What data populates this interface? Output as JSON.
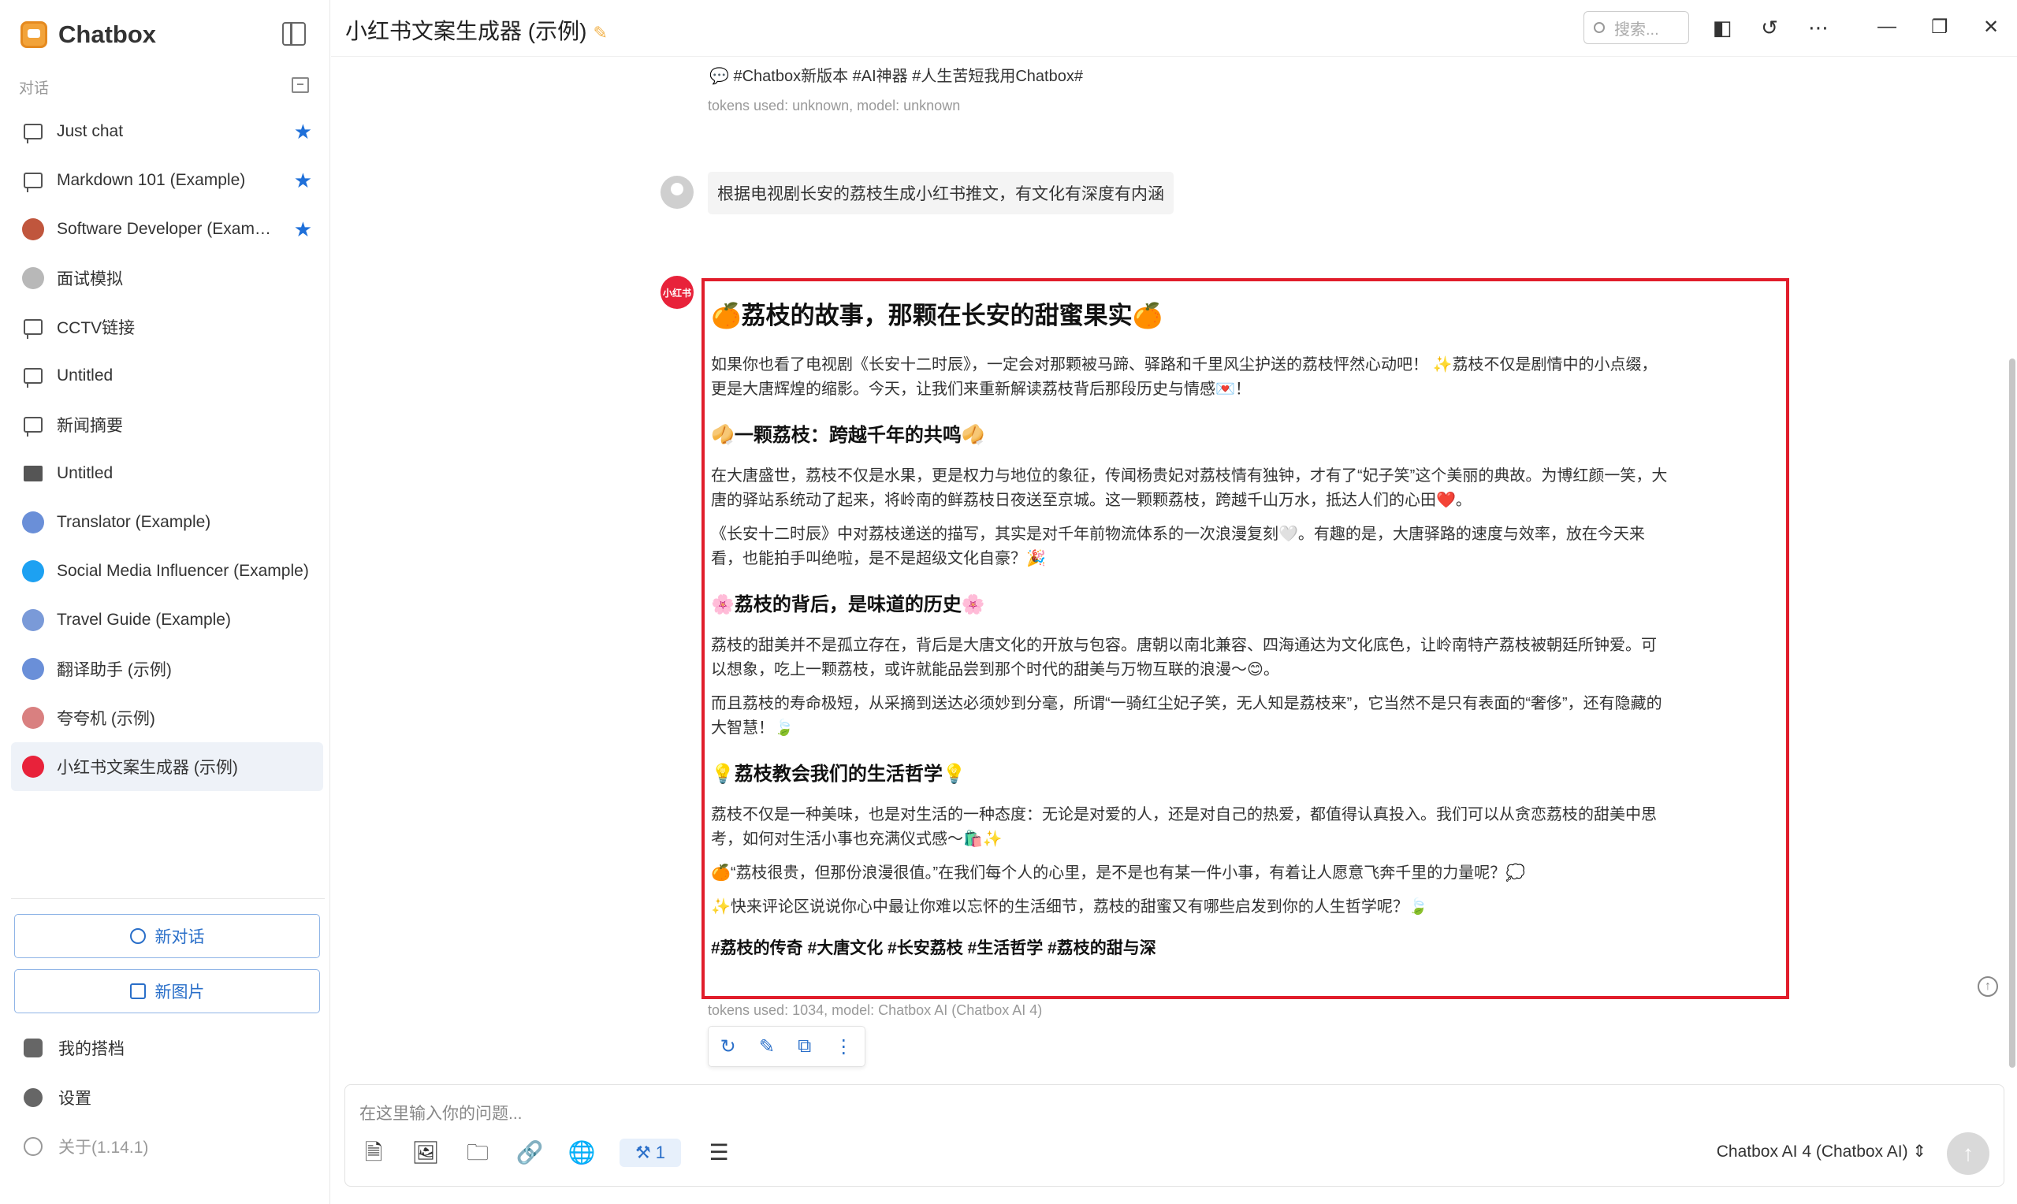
{
  "app": {
    "name": "Chatbox",
    "version_label": "关于(1.14.1)"
  },
  "sidebar": {
    "section_label": "对话",
    "items": [
      {
        "label": "Just chat",
        "starred": true,
        "icon": "chat-icon"
      },
      {
        "label": "Markdown 101 (Example)",
        "starred": true,
        "icon": "chat-icon"
      },
      {
        "label": "Software Developer (Exam…",
        "starred": true,
        "icon": "developer-avatar"
      },
      {
        "label": "面试模拟",
        "starred": false,
        "icon": "user-avatar"
      },
      {
        "label": "CCTV链接",
        "starred": false,
        "icon": "chat-icon"
      },
      {
        "label": "Untitled",
        "starred": false,
        "icon": "chat-icon"
      },
      {
        "label": "新闻摘要",
        "starred": false,
        "icon": "chat-icon"
      },
      {
        "label": "Untitled",
        "starred": false,
        "icon": "image-icon"
      },
      {
        "label": "Translator (Example)",
        "starred": false,
        "icon": "translator-avatar"
      },
      {
        "label": "Social Media Influencer (Example)",
        "starred": false,
        "icon": "twitter-avatar"
      },
      {
        "label": "Travel Guide (Example)",
        "starred": false,
        "icon": "globe-avatar"
      },
      {
        "label": "翻译助手 (示例)",
        "starred": false,
        "icon": "translator-avatar"
      },
      {
        "label": "夸夸机 (示例)",
        "starred": false,
        "icon": "flower-avatar"
      },
      {
        "label": "小红书文案生成器 (示例)",
        "starred": false,
        "icon": "xiaohongshu-avatar",
        "active": true
      }
    ],
    "new_chat_label": "新对话",
    "new_image_label": "新图片",
    "my_partner_label": "我的搭档",
    "settings_label": "设置"
  },
  "header": {
    "title": "小红书文案生成器 (示例)",
    "search_placeholder": "搜索..."
  },
  "chat": {
    "prev_hashtags": "#Chatbox新版本 #AI神器 #人生苦短我用Chatbox#",
    "prev_meta": "tokens used: unknown, model: unknown",
    "user_message": "根据电视剧长安的荔枝生成小红书推文，有文化有深度有内涵",
    "bot_avatar_text": "小红书",
    "answer": {
      "h1": "🍊荔枝的故事，那颗在长安的甜蜜果实🍊",
      "p1": "如果你也看了电视剧《长安十二时辰》，一定会对那颗被马蹄、驿路和千里风尘护送的荔枝怦然心动吧！ ✨荔枝不仅是剧情中的小点缀，更是大唐辉煌的缩影。今天，让我们来重新解读荔枝背后那段历史与情感💌！",
      "h2a": "🥠一颗荔枝：跨越千年的共鸣🥠",
      "p2": "在大唐盛世，荔枝不仅是水果，更是权力与地位的象征，传闻杨贵妃对荔枝情有独钟，才有了“妃子笑”这个美丽的典故。为博红颜一笑，大唐的驿站系统动了起来，将岭南的鲜荔枝日夜送至京城。这一颗颗荔枝，跨越千山万水，抵达人们的心田❤️。",
      "p3": "《长安十二时辰》中对荔枝递送的描写，其实是对千年前物流体系的一次浪漫复刻🤍。有趣的是，大唐驿路的速度与效率，放在今天来看，也能拍手叫绝啦，是不是超级文化自豪？🎉",
      "h2b": "🌸荔枝的背后，是味道的历史🌸",
      "p4": "荔枝的甜美并不是孤立存在，背后是大唐文化的开放与包容。唐朝以南北兼容、四海通达为文化底色，让岭南特产荔枝被朝廷所钟爱。可以想象，吃上一颗荔枝，或许就能品尝到那个时代的甜美与万物互联的浪漫～😊。",
      "p5": "而且荔枝的寿命极短，从采摘到送达必须妙到分毫，所谓“一骑红尘妃子笑，无人知是荔枝来”，它当然不是只有表面的“奢侈”，还有隐藏的大智慧！🍃",
      "h2c": "💡荔枝教会我们的生活哲学💡",
      "p6": "荔枝不仅是一种美味，也是对生活的一种态度：无论是对爱的人，还是对自己的热爱，都值得认真投入。我们可以从贪恋荔枝的甜美中思考，如何对生活小事也充满仪式感～🛍️✨",
      "p7": "🍊“荔枝很贵，但那份浪漫很值。”在我们每个人的心里，是不是也有某一件小事，有着让人愿意飞奔千里的力量呢？💭",
      "p8": "✨快来评论区说说你心中最让你难以忘怀的生活细节，荔枝的甜蜜又有哪些启发到你的人生哲学呢？🍃",
      "tags": "#荔枝的传奇 #大唐文化 #长安荔枝 #生活哲学 #荔枝的甜与深"
    },
    "answer_meta": "tokens used: 1034, model: Chatbox AI (Chatbox AI 4)"
  },
  "input": {
    "placeholder": "在这里输入你的问题...",
    "tool_count": "1",
    "model_selector": "Chatbox AI 4 (Chatbox AI) ⇕"
  },
  "colors": {
    "accent": "#2a6fc9",
    "highlight_border": "#e11d2b",
    "star": "#1e6fd9"
  }
}
